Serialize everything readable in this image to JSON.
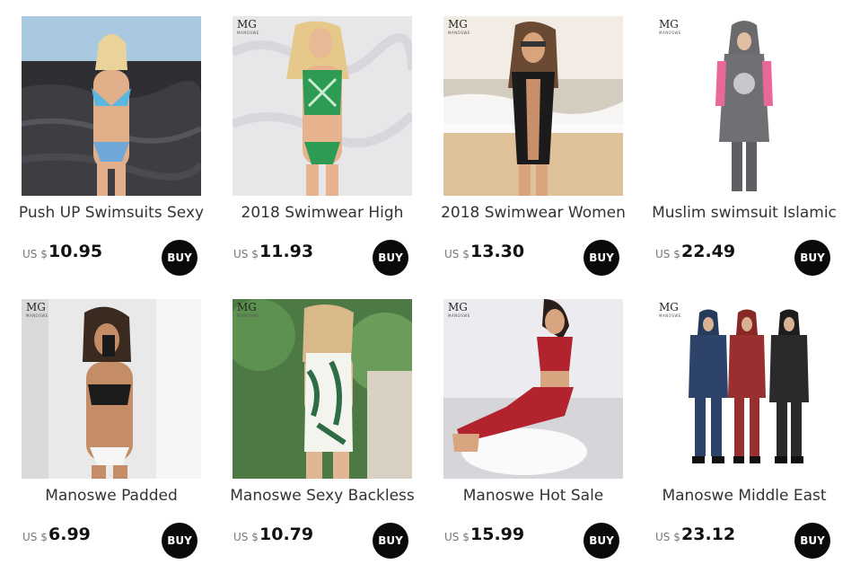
{
  "products": [
    {
      "title": "Push UP Swimsuits Sexy",
      "currency": "US $",
      "price": "10.95",
      "buy_label": "BUY",
      "has_brand_mark": false
    },
    {
      "title": "2018 Swimwear High",
      "currency": "US $",
      "price": "11.93",
      "buy_label": "BUY",
      "has_brand_mark": true
    },
    {
      "title": "2018 Swimwear Women",
      "currency": "US $",
      "price": "13.30",
      "buy_label": "BUY",
      "has_brand_mark": true
    },
    {
      "title": "Muslim swimsuit Islamic",
      "currency": "US $",
      "price": "22.49",
      "buy_label": "BUY",
      "has_brand_mark": true
    },
    {
      "title": "Manoswe Padded",
      "currency": "US $",
      "price": "6.99",
      "buy_label": "BUY",
      "has_brand_mark": true
    },
    {
      "title": "Manoswe Sexy Backless",
      "currency": "US $",
      "price": "10.79",
      "buy_label": "BUY",
      "has_brand_mark": true
    },
    {
      "title": "Manoswe Hot Sale",
      "currency": "US $",
      "price": "15.99",
      "buy_label": "BUY",
      "has_brand_mark": true
    },
    {
      "title": "Manoswe Middle East",
      "currency": "US $",
      "price": "23.12",
      "buy_label": "BUY",
      "has_brand_mark": true
    }
  ],
  "brand_mark": {
    "logo": "MG",
    "sub": "MANOSWE"
  },
  "colors": {
    "buy_button": "#0a0a0a",
    "price_text": "#111111",
    "title_text": "#333333",
    "currency_text": "#777777"
  }
}
